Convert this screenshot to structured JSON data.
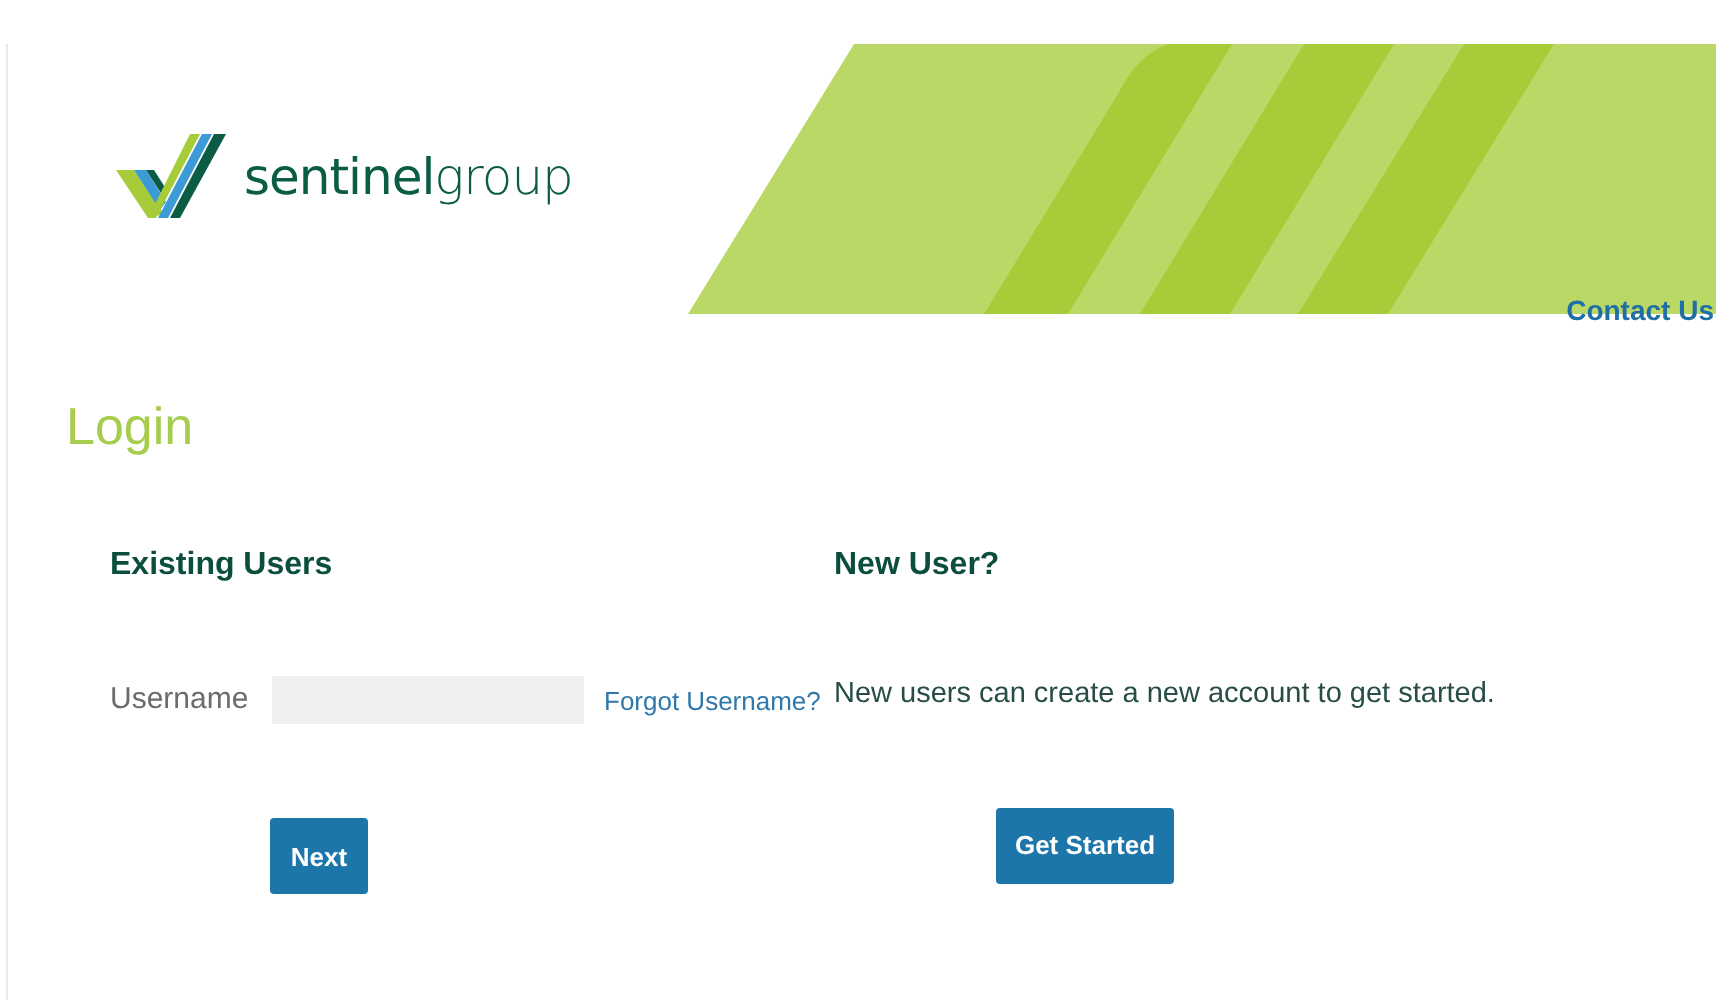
{
  "header": {
    "logo": "**sentinel**group",
    "contact_link": "Contact Us"
  },
  "page_title": "Login",
  "existing_users": {
    "heading": "Existing Users",
    "username_label": "Username",
    "forgot_link": "Forgot Username?",
    "button": "Next"
  },
  "new_user": {
    "heading": "New User?",
    "text": "New users can create a new account to get started.",
    "button": "Get Started"
  }
}
